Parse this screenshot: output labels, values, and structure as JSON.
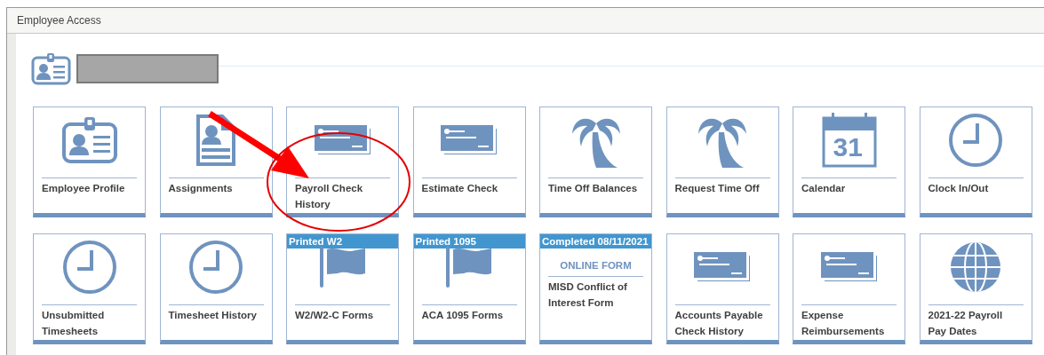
{
  "window": {
    "title": "Employee Access"
  },
  "header": {
    "name_redacted": true
  },
  "tiles": [
    {
      "label": "Employee Profile",
      "kind": "id-card"
    },
    {
      "label": "Assignments",
      "kind": "document"
    },
    {
      "label": "Payroll Check History",
      "kind": "check"
    },
    {
      "label": "Estimate Check",
      "kind": "check"
    },
    {
      "label": "Time Off Balances",
      "kind": "palm"
    },
    {
      "label": "Request Time Off",
      "kind": "palm"
    },
    {
      "label": "Calendar",
      "kind": "calendar",
      "icon_text": "31"
    },
    {
      "label": "Clock In/Out",
      "kind": "clock"
    },
    {
      "label": "Unsubmitted Timesheets",
      "kind": "clock"
    },
    {
      "label": "Timesheet History",
      "kind": "clock"
    },
    {
      "label": "W2/W2-C Forms",
      "kind": "flag",
      "badge": "Printed W2"
    },
    {
      "label": "ACA 1095 Forms",
      "kind": "flag",
      "badge": "Printed 1095"
    },
    {
      "label": "MISD Conflict of Interest Form",
      "kind": "form",
      "badge": "Completed 08/11/2021",
      "subtitle": "ONLINE FORM"
    },
    {
      "label": "Accounts Payable Check History",
      "kind": "check"
    },
    {
      "label": "Expense Reimbursements",
      "kind": "check"
    },
    {
      "label": "2021-22 Payroll Pay Dates",
      "kind": "globe"
    }
  ],
  "markup": [
    {
      "kind": "arrow"
    },
    {
      "kind": "ellipse"
    }
  ]
}
